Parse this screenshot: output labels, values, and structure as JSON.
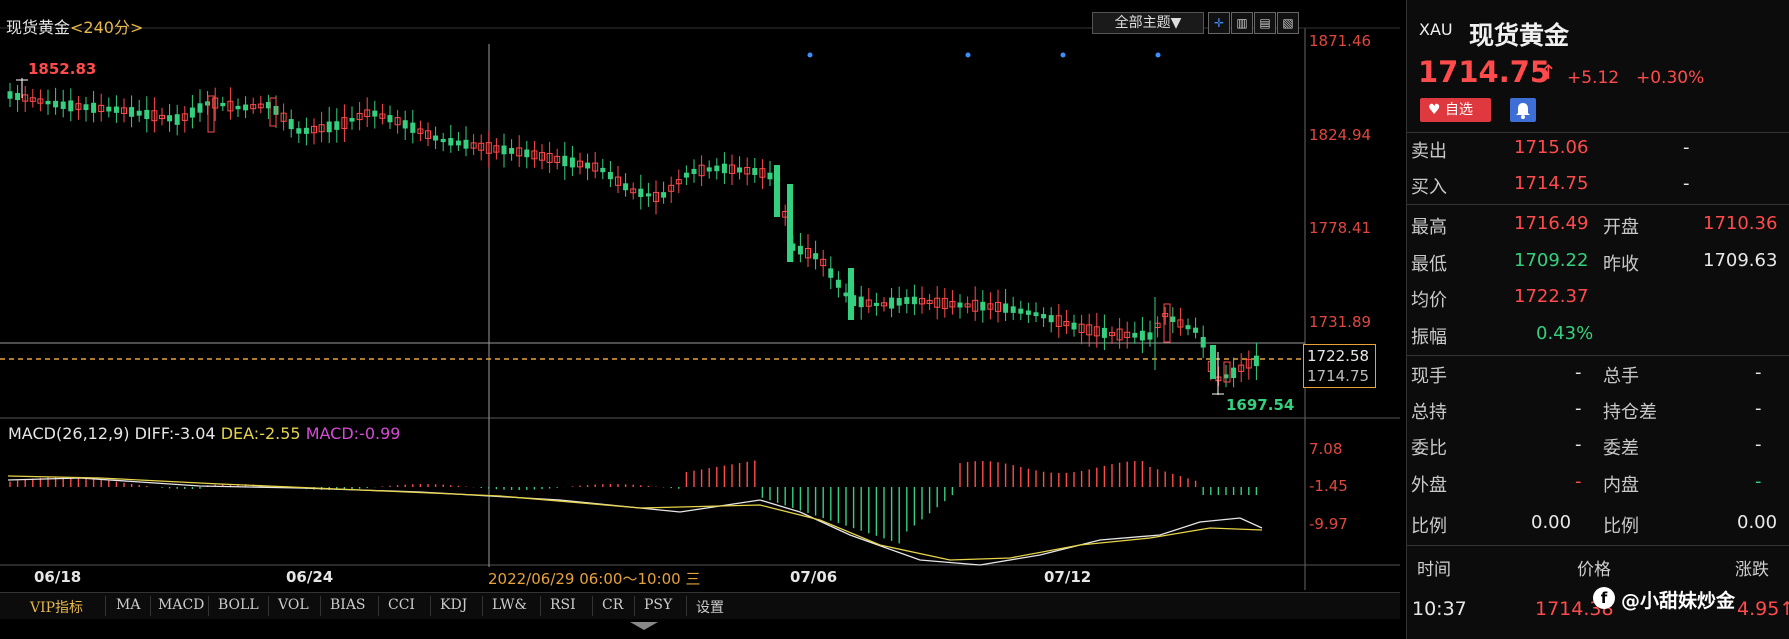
{
  "header": {
    "title": "现货黄金",
    "period": "<240分>",
    "theme_button": "全部主题▼",
    "tool_icons": [
      "crosshair-icon",
      "kline-icon-1",
      "kline-icon-2",
      "kline-icon-3"
    ]
  },
  "price_axis": [
    "1871.46",
    "1824.94",
    "1778.41",
    "1731.89",
    "1697.54"
  ],
  "price_box": {
    "cursor_price": "1722.58",
    "last_price": "1714.75"
  },
  "markers": {
    "high": "1852.83",
    "low": "1697.54"
  },
  "macd": {
    "title": "MACD(26,12,9)",
    "diff": "DIFF:-3.04",
    "dea": "DEA:-2.55",
    "macd": "MACD:-0.99",
    "axis": [
      "7.08",
      "-1.45",
      "-9.97"
    ]
  },
  "x_dates": [
    "06/18",
    "06/24",
    "07/06",
    "07/12"
  ],
  "cursor_date": "2022/06/29 06:00～10:00 三",
  "indicator_tabs": [
    "VIP指标",
    "MA",
    "MACD",
    "BOLL",
    "VOL",
    "BIAS",
    "CCI",
    "KDJ",
    "LW&",
    "RSI",
    "CR",
    "PSY",
    "设置"
  ],
  "side": {
    "symbol": "XAU",
    "name": "现货黄金",
    "price": "1714.75",
    "arrow": "↑",
    "change": "+5.12",
    "change_pct": "+0.30%",
    "fav_label": "♥ 自选",
    "sell": {
      "label": "卖出",
      "value": "1715.06",
      "extra": "-"
    },
    "buy": {
      "label": "买入",
      "value": "1714.75",
      "extra": "-"
    },
    "rows": [
      {
        "l1": "最高",
        "v1": "1716.49",
        "l2": "开盘",
        "v2": "1710.36"
      },
      {
        "l1": "最低",
        "v1": "1709.22",
        "l2": "昨收",
        "v2": "1709.63"
      },
      {
        "l1": "均价",
        "v1": "1722.37"
      },
      {
        "l1": "振幅",
        "v1": "0.43%"
      }
    ],
    "rows2": [
      {
        "l1": "现手",
        "v1": "-",
        "l2": "总手",
        "v2": "-"
      },
      {
        "l1": "总持",
        "v1": "-",
        "l2": "持仓差",
        "v2": "-"
      },
      {
        "l1": "委比",
        "v1": "-",
        "l2": "委差",
        "v2": "-"
      },
      {
        "l1": "外盘",
        "v1": "-",
        "l2": "内盘",
        "v2": "-"
      },
      {
        "l1": "比例",
        "v1": "0.00",
        "l2": "比例",
        "v2": "0.00"
      }
    ],
    "tick_header": [
      "时间",
      "价格",
      "涨跌"
    ],
    "tick_row": {
      "time": "10:37",
      "price": "1714.38",
      "change": "4.95↑"
    },
    "watermark": "@小甜妹炒金",
    "watermark_icon": "f"
  },
  "colors": {
    "up": "#ff4b4b",
    "down": "#35d07f",
    "dea": "#e6d44a",
    "macd": "#d64bd6",
    "accent": "#e8a23c"
  }
}
